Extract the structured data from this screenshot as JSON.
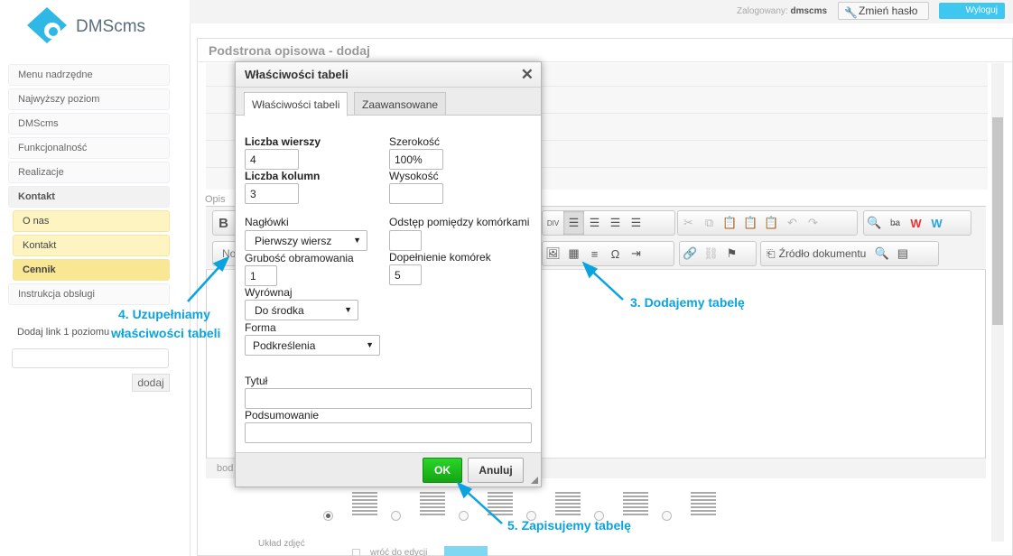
{
  "app": {
    "logo_text": "DMScms"
  },
  "sidebar": {
    "items": [
      {
        "label": "Menu nadrzędne"
      },
      {
        "label": "Najwyższy poziom"
      },
      {
        "label": "DMScms"
      },
      {
        "label": "Funkcjonalność"
      },
      {
        "label": "Realizacje"
      },
      {
        "label": "Kontakt"
      },
      {
        "label": "O nas"
      },
      {
        "label": "Kontakt"
      },
      {
        "label": "Cennik"
      },
      {
        "label": "Instrukcja obsługi"
      }
    ],
    "add_link_label": "Dodaj link 1 poziomu",
    "add_link_value": "",
    "add_button": "dodaj"
  },
  "topbar": {
    "logged_label": "Zalogowany:",
    "username": "dmscms",
    "change_password": "Zmień hasło",
    "logout": "Wyloguj",
    "accent_color": "#3ec8f0"
  },
  "page": {
    "title": "Podstrona opisowa - dodaj",
    "description_label": "Opis",
    "status_path": "bod",
    "layout_label": "Układ zdjęć",
    "back_label": "wróć do edycji",
    "selected_layout": 1
  },
  "editor": {
    "toolbar": {
      "bold": "B",
      "format_placeholder": "No",
      "source_label": "Źródło dokumentu"
    }
  },
  "dialog": {
    "title": "Właściwości tabeli",
    "tabs": [
      "Właściwości tabeli",
      "Zaawansowane"
    ],
    "rows_label": "Liczba wierszy",
    "rows_value": "4",
    "cols_label": "Liczba kolumn",
    "cols_value": "3",
    "width_label": "Szerokość",
    "width_value": "100%",
    "height_label": "Wysokość",
    "height_value": "",
    "headers_label": "Nagłówki",
    "headers_value": "Pierwszy wiersz",
    "spacing_label": "Odstęp pomiędzy komórkami",
    "spacing_value": "",
    "border_label": "Grubość obramowania",
    "border_value": "1",
    "padding_label": "Dopełnienie komórek",
    "padding_value": "5",
    "align_label": "Wyrównaj",
    "align_value": "Do środka",
    "form_label": "Forma",
    "form_value": "Podkreślenia",
    "caption_label": "Tytuł",
    "caption_value": "",
    "summary_label": "Podsumowanie",
    "summary_value": "",
    "ok": "OK",
    "cancel": "Anuluj",
    "ok_color": "#1ec21e"
  },
  "annotations": {
    "step3": "3. Dodajemy tabelę",
    "step4_line1": "4. Uzupełniamy",
    "step4_line2": "właściwości tabeli",
    "step5": "5. Zapisujemy tabelę",
    "color": "#0aa3e0"
  }
}
